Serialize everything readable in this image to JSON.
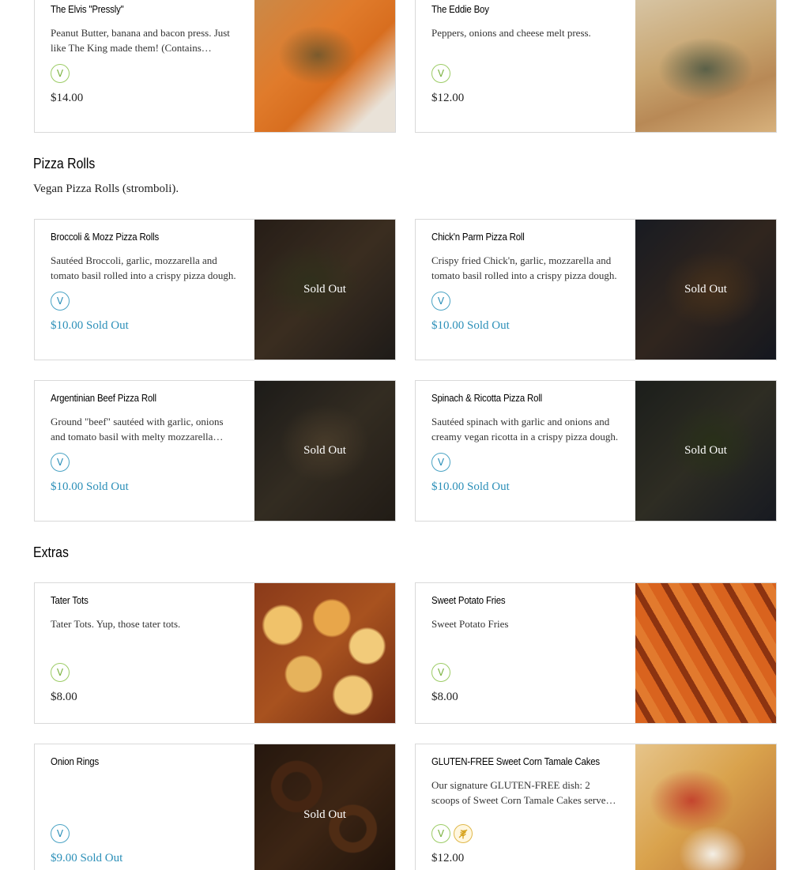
{
  "rows_top": [
    {
      "name": "The Elvis \"Pressly\"",
      "desc": "Peanut Butter, banana and bacon press. Just like The King made them! (Contains peanuts)",
      "price": "$14.00"
    },
    {
      "name": "The Eddie Boy",
      "desc": "Peppers, onions and cheese melt press.",
      "price": "$12.00"
    }
  ],
  "sections": {
    "pizza_rolls": {
      "title": "Pizza Rolls",
      "desc": "Vegan Pizza Rolls (stromboli).",
      "items": [
        {
          "name": "Broccoli & Mozz Pizza Rolls",
          "desc": "Sautéed Broccoli, garlic, mozzarella and tomato basil rolled into a crispy pizza dough.",
          "price": "$10.00",
          "sold_label": "Sold Out",
          "overlay": "Sold Out"
        },
        {
          "name": "Chick'n Parm Pizza Roll",
          "desc": "Crispy fried Chick'n, garlic, mozzarella and tomato basil rolled into a crispy pizza dough.",
          "price": "$10.00",
          "sold_label": "Sold Out",
          "overlay": "Sold Out"
        },
        {
          "name": "Argentinian Beef Pizza Roll",
          "desc": "Ground \"beef\" sautéed with garlic, onions and tomato basil with melty mozzarella rolled.",
          "price": "$10.00",
          "sold_label": "Sold Out",
          "overlay": "Sold Out"
        },
        {
          "name": "Spinach & Ricotta Pizza Roll",
          "desc": "Sautéed spinach with garlic and onions and creamy vegan ricotta in a crispy pizza dough.",
          "price": "$10.00",
          "sold_label": "Sold Out",
          "overlay": "Sold Out"
        }
      ]
    },
    "extras": {
      "title": "Extras",
      "items": [
        {
          "name": "Tater Tots",
          "desc": "Tater Tots. Yup, those tater tots.",
          "price": "$8.00"
        },
        {
          "name": "Sweet Potato Fries",
          "desc": "Sweet Potato Fries",
          "price": "$8.00"
        },
        {
          "name": "Onion Rings",
          "desc": "",
          "price": "$9.00",
          "sold_label": "Sold Out",
          "overlay": "Sold Out"
        },
        {
          "name": "GLUTEN-FREE Sweet Corn Tamale Cakes",
          "desc": "Our signature GLUTEN-FREE dish: 2 scoops of Sweet Corn Tamale Cakes served with salsa.",
          "price": "$12.00"
        }
      ]
    }
  },
  "icons": {
    "vegan": "V",
    "gluten_free": "gluten-free-wheat-icon"
  },
  "colors": {
    "sold_out_price": "#2b8fb8",
    "vegan_badge": "#7cb342",
    "sold_vegan_badge": "#2b8fb8",
    "gluten_free_badge": "#d6a21c"
  }
}
